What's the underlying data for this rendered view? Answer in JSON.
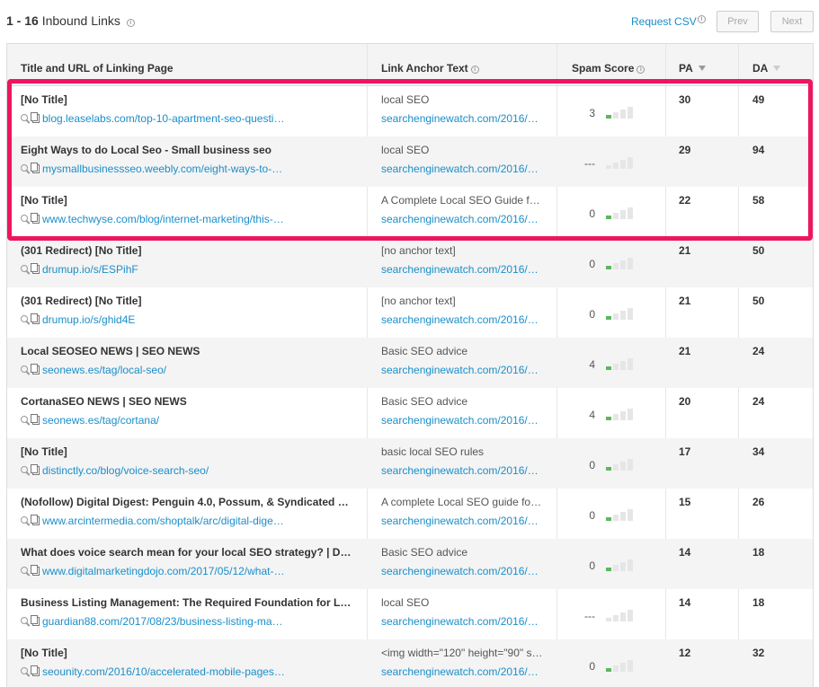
{
  "header": {
    "range": "1 - 16",
    "label": "Inbound Links",
    "info_icon": "i",
    "request_csv": "Request CSV",
    "prev": "Prev",
    "next": "Next"
  },
  "columns": {
    "title": "Title and URL of Linking Page",
    "anchor": "Link Anchor Text",
    "spam": "Spam Score",
    "pa": "PA",
    "da": "DA"
  },
  "rows": [
    {
      "title": "[No Title]",
      "url": "blog.leaselabs.com/top-10-apartment-seo-questi…",
      "anchor": "local SEO",
      "target": "searchenginewatch.com/2016/…",
      "spam": "3",
      "spam_level": 1,
      "pa": "30",
      "da": "49"
    },
    {
      "title": "Eight Ways to do Local Seo - Small business seo",
      "url": "mysmallbusinessseo.weebly.com/eight-ways-to-…",
      "anchor": "local SEO",
      "target": "searchenginewatch.com/2016/…",
      "spam": "---",
      "spam_level": 0,
      "pa": "29",
      "da": "94"
    },
    {
      "title": "[No Title]",
      "url": "www.techwyse.com/blog/internet-marketing/this-…",
      "anchor": "A Complete Local SEO Guide f…",
      "target": "searchenginewatch.com/2016/…",
      "spam": "0",
      "spam_level": 1,
      "pa": "22",
      "da": "58"
    },
    {
      "title": "(301 Redirect) [No Title]",
      "url": "drumup.io/s/ESPihF",
      "anchor": "[no anchor text]",
      "target": "searchenginewatch.com/2016/…",
      "spam": "0",
      "spam_level": 1,
      "pa": "21",
      "da": "50"
    },
    {
      "title": "(301 Redirect) [No Title]",
      "url": "drumup.io/s/ghid4E",
      "anchor": "[no anchor text]",
      "target": "searchenginewatch.com/2016/…",
      "spam": "0",
      "spam_level": 1,
      "pa": "21",
      "da": "50"
    },
    {
      "title": "Local SEOSEO NEWS | SEO NEWS",
      "url": "seonews.es/tag/local-seo/",
      "anchor": "Basic SEO advice",
      "target": "searchenginewatch.com/2016/…",
      "spam": "4",
      "spam_level": 1,
      "pa": "21",
      "da": "24"
    },
    {
      "title": "CortanaSEO NEWS | SEO NEWS",
      "url": "seonews.es/tag/cortana/",
      "anchor": "Basic SEO advice",
      "target": "searchenginewatch.com/2016/…",
      "spam": "4",
      "spam_level": 1,
      "pa": "20",
      "da": "24"
    },
    {
      "title": "[No Title]",
      "url": "distinctly.co/blog/voice-search-seo/",
      "anchor": "basic local SEO rules",
      "target": "searchenginewatch.com/2016/…",
      "spam": "0",
      "spam_level": 1,
      "pa": "17",
      "da": "34"
    },
    {
      "title": "(Nofollow) Digital Digest: Penguin 4.0, Possum, & Syndicated …",
      "url": "www.arcintermedia.com/shoptalk/arc/digital-dige…",
      "anchor": "A complete Local SEO guide fo…",
      "target": "searchenginewatch.com/2016/…",
      "spam": "0",
      "spam_level": 1,
      "pa": "15",
      "da": "26"
    },
    {
      "title": "What does voice search mean for your local SEO strategy? | D…",
      "url": "www.digitalmarketingdojo.com/2017/05/12/what-…",
      "anchor": "Basic SEO advice",
      "target": "searchenginewatch.com/2016/…",
      "spam": "0",
      "spam_level": 1,
      "pa": "14",
      "da": "18"
    },
    {
      "title": "Business Listing Management: The Required Foundation for L…",
      "url": "guardian88.com/2017/08/23/business-listing-ma…",
      "anchor": "local SEO",
      "target": "searchenginewatch.com/2016/…",
      "spam": "---",
      "spam_level": 0,
      "pa": "14",
      "da": "18"
    },
    {
      "title": "[No Title]",
      "url": "seounity.com/2016/10/accelerated-mobile-pages…",
      "anchor": "<img width=\"120\" height=\"90\" s…",
      "target": "searchenginewatch.com/2016/…",
      "spam": "0",
      "spam_level": 1,
      "pa": "12",
      "da": "32"
    }
  ],
  "colors": {
    "link": "#1a8ec9",
    "highlight": "#ee1560",
    "spam_bar_on": "#5cb85c"
  }
}
